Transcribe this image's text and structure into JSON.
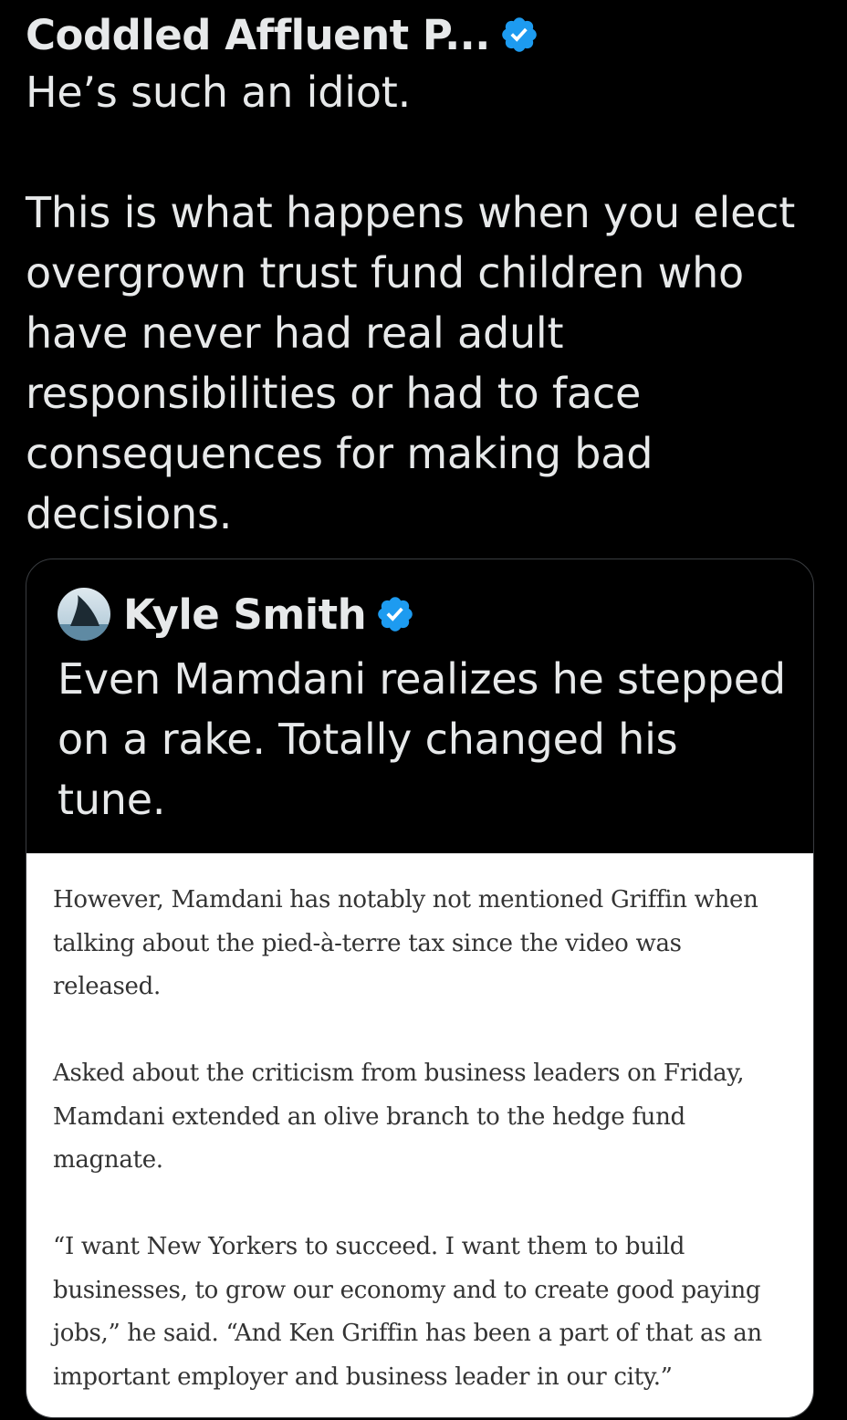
{
  "post": {
    "author_name": "Coddled Affluent P...",
    "text": "He’s such an idiot.\n\nThis is what happens when you elect overgrown trust fund children who have never had real adult responsibilities or had to face consequences for making bad decisions."
  },
  "quoted_post": {
    "author_name": "Kyle Smith",
    "text": "Even Mamdani realizes he stepped on a rake.  Totally changed his tune.",
    "article_image": {
      "paragraphs": [
        "However, Mamdani has notably not mentioned Griffin when talking about the pied-à-terre tax since the video was released.",
        "Asked about the criticism from business leaders on Friday, Mamdani extended an olive branch to the hedge fund magnate.",
        "“I want New Yorkers to succeed. I want them to build businesses, to grow our economy and to create good paying jobs,” he said. “And Ken Griffin has been a part of that as an important employer and business leader in our city.”"
      ]
    }
  },
  "icons": {
    "verified_badge": "verified-badge-icon",
    "avatar": "shark-fin-avatar"
  },
  "colors": {
    "background": "#000000",
    "text": "#e7e9ea",
    "verified_blue": "#1d9bf0",
    "card_border": "#3a3d41",
    "article_text": "#333333"
  }
}
